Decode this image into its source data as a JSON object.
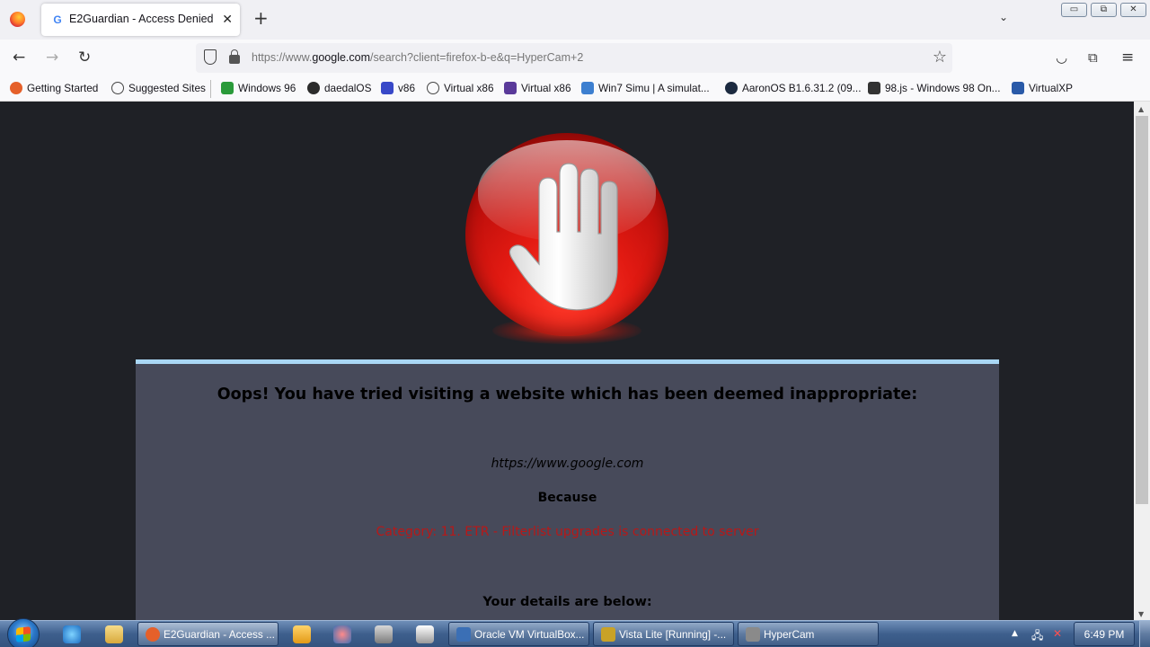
{
  "browser": {
    "tab": {
      "title": "E2Guardian - Access Denied",
      "favicon": "G"
    },
    "new_tab_label": "+",
    "url": {
      "prefix": "https://www.",
      "domain": "google.com",
      "path": "/search?client=firefox-b-e&q=HyperCam+2"
    }
  },
  "bookmarks": [
    {
      "label": "Getting Started",
      "icon": "firefox-icon",
      "color": "#e5602a"
    },
    {
      "label": "Suggested Sites",
      "icon": "globe-icon",
      "color": ""
    },
    {
      "label": "Windows 96",
      "icon": "windows96-icon",
      "color": "#2a9a3a"
    },
    {
      "label": "daedalOS",
      "icon": "daedalos-icon",
      "color": "#2c2c2c"
    },
    {
      "label": "v86",
      "icon": "v86-icon",
      "color": "#3848c8"
    },
    {
      "label": "Virtual x86",
      "icon": "globe-icon",
      "color": ""
    },
    {
      "label": "Virtual x86",
      "icon": "virtualx86-icon",
      "color": "#5a3a9a"
    },
    {
      "label": "Win7 Simu | A simulat...",
      "icon": "win7simu-icon",
      "color": "#3d7fd0"
    },
    {
      "label": "AaronOS B1.6.31.2 (09...",
      "icon": "aaronos-icon",
      "color": "#1c2a40"
    },
    {
      "label": "98.js - Windows 98 On...",
      "icon": "98js-icon",
      "color": "#333"
    },
    {
      "label": "VirtualXP",
      "icon": "virtualxp-icon",
      "color": "#2a5aa8"
    }
  ],
  "page": {
    "headline": "Oops! You have tried visiting a website which has been deemed inappropriate:",
    "blocked_url": "https://www.google.com",
    "because_label": "Because",
    "reason": "Category: 11. ETR - Filterlist upgrades is connected to server",
    "details_label": "Your details are below:",
    "colors": {
      "background": "#1f2126",
      "panel": "#474a5a",
      "panel_border": "#a9d7f5",
      "reason": "#b81818"
    }
  },
  "taskbar": {
    "tasks": [
      {
        "label": "E2Guardian - Access ...",
        "icon": "firefox-icon",
        "color": "#e5602a"
      },
      {
        "label": "Oracle VM VirtualBox...",
        "icon": "virtualbox-icon",
        "color": "#3b6fb5"
      },
      {
        "label": "Vista Lite [Running] -...",
        "icon": "vm-window-icon",
        "color": "#c9a227"
      },
      {
        "label": "HyperCam",
        "icon": "hypercam-icon",
        "color": "#8a8a8a"
      }
    ],
    "clock": "6:49 PM"
  }
}
